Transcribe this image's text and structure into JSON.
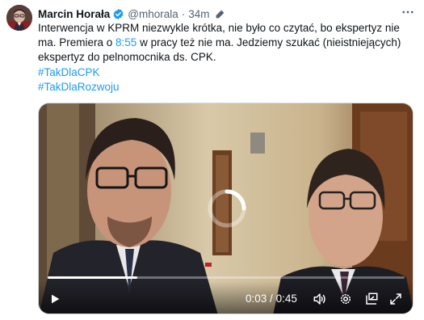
{
  "author": {
    "name": "Marcin Horała",
    "handle": "@mhorala",
    "separator": "·",
    "time": "34m"
  },
  "tweet": {
    "line1": "Interwencja w KPRM niezwykle krótka, nie było co czytać, bo ekspertyz nie",
    "line2_pre": "ma. Premiera o ",
    "line2_time": "8:55",
    "line2_post": " w pracy też nie ma. Jedziemy szukać (nieistniejących)",
    "line3": "ekspertyz do pelnomocnika ds. CPK.",
    "hashtag1": "#TakDlaCPK",
    "hashtag2": "#TakDlaRozwoju"
  },
  "video": {
    "current_time": "0:03",
    "separator": "/",
    "duration": "0:45",
    "progress_fraction": 0.25
  },
  "colors": {
    "link": "#1d9bf0",
    "verified": "#1d9bf0",
    "secondary_text": "#536471"
  },
  "icons": {
    "verified": "verified-badge-icon",
    "edit": "pencil-icon",
    "more": "more-icon",
    "play": "play-icon",
    "volume": "volume-icon",
    "settings": "settings-icon",
    "pip": "picture-in-picture-icon",
    "fullscreen": "fullscreen-icon",
    "loading": "loading-spinner-icon"
  }
}
